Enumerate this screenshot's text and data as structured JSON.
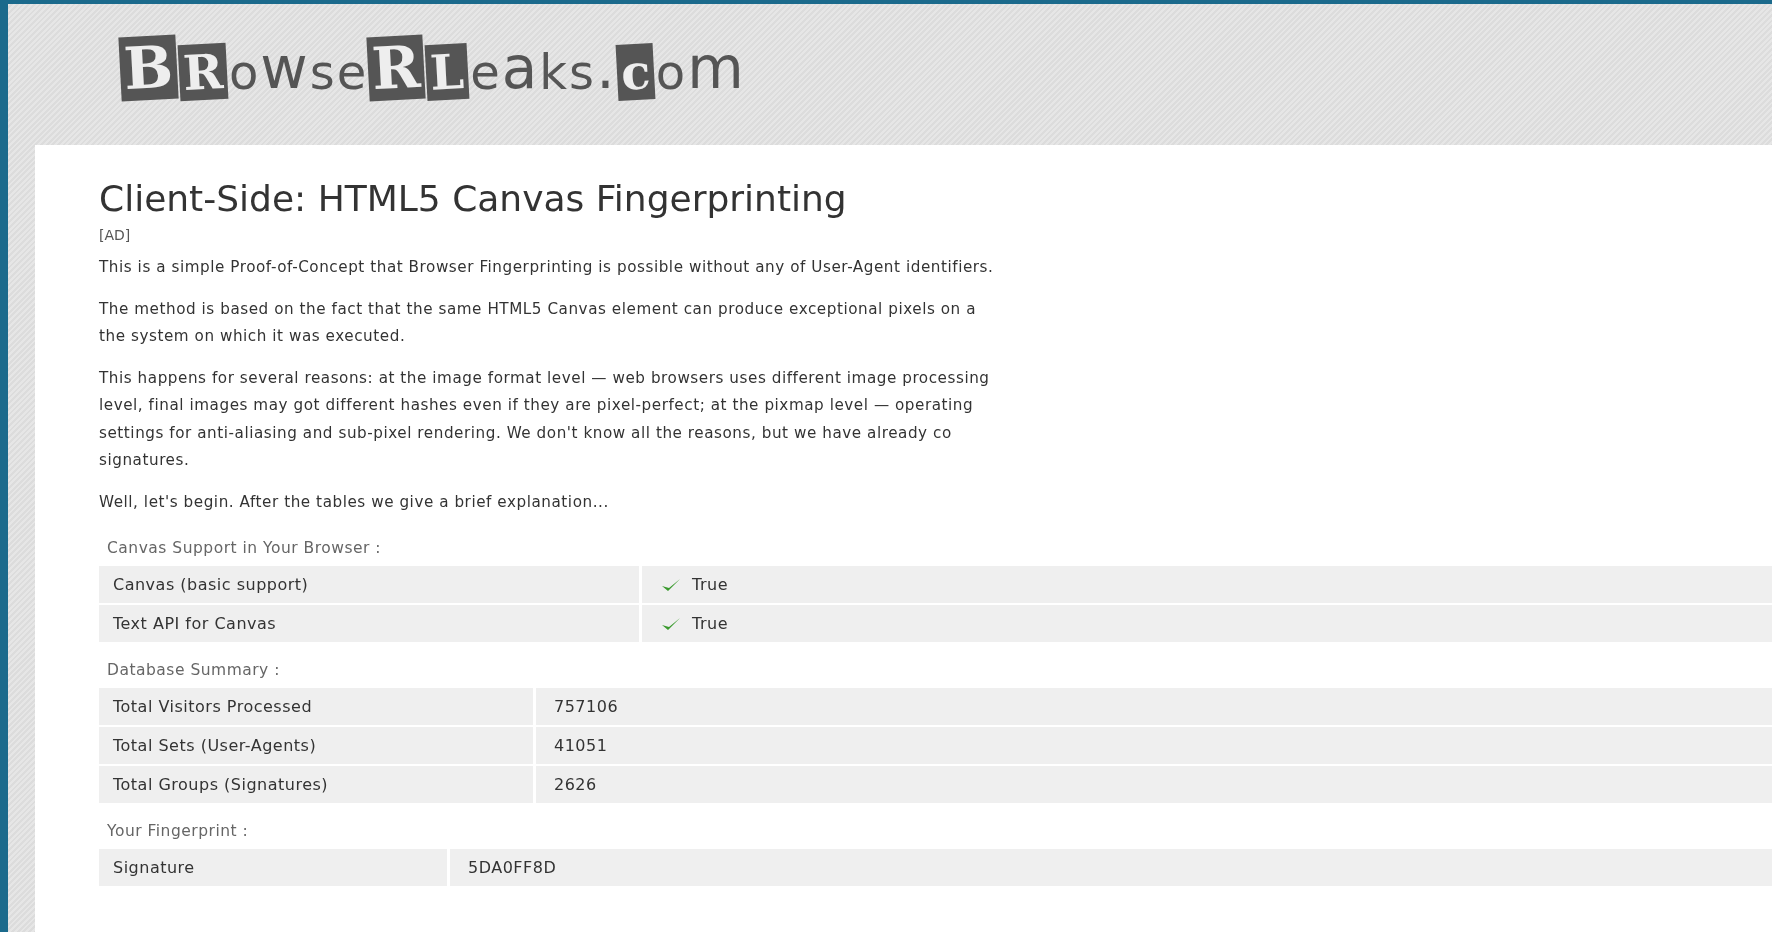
{
  "logo": "BRowseRLeaks.com",
  "title": "Client-Side: HTML5 Canvas Fingerprinting",
  "ad": "[AD]",
  "paragraphs": [
    [
      "This is a simple Proof-of-Concept that Browser Fingerprinting is possible without any of User-Agent identifiers."
    ],
    [
      "The method is based on the fact that the same HTML5 Canvas element can produce exceptional pixels on a",
      "the system on which it was executed."
    ],
    [
      "This happens for several reasons: at the image format level — web browsers uses different image processing",
      "level, final images may got different hashes even if they are pixel-perfect; at the pixmap level — operating",
      "settings for anti-aliasing and sub-pixel rendering. We don't know all the reasons, but we have already co",
      "signatures."
    ],
    [
      "Well, let's begin. After the tables we give a brief explanation..."
    ]
  ],
  "sections": [
    {
      "label": "Canvas Support in Your Browser :",
      "rows": [
        {
          "name": "Canvas (basic support)",
          "value": "True",
          "checked": true
        },
        {
          "name": "Text API for Canvas",
          "value": "True",
          "checked": true
        }
      ]
    },
    {
      "label": "Database Summary :",
      "rows": [
        {
          "name": "Total Visitors Processed",
          "value": "757106"
        },
        {
          "name": "Total Sets (User-Agents)",
          "value": "41051"
        },
        {
          "name": "Total Groups (Signatures)",
          "value": "2626"
        }
      ]
    },
    {
      "label": "Your Fingerprint :",
      "rows": [
        {
          "name": "Signature",
          "value": "5DA0FF8D"
        }
      ]
    }
  ]
}
